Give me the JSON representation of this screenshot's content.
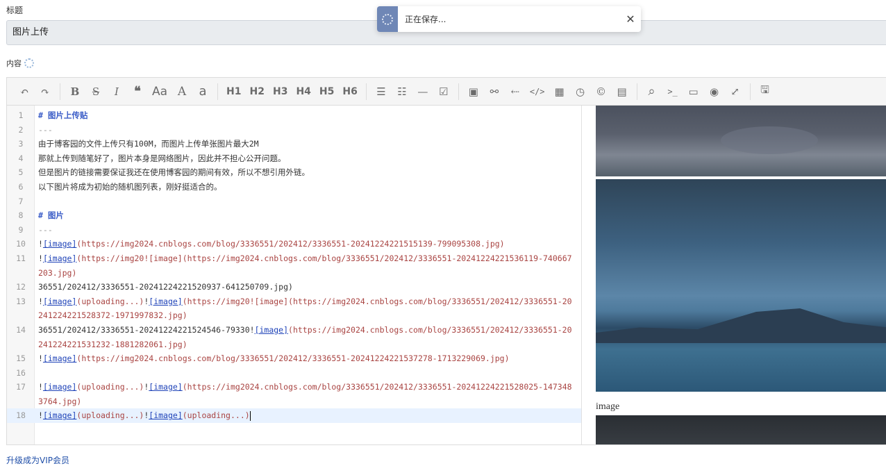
{
  "form": {
    "title_label": "标题",
    "title_value": "图片上传",
    "content_label": "内容"
  },
  "toast": {
    "message": "正在保存...",
    "close_glyph": "✕"
  },
  "toolbar": {
    "undo": "↶",
    "redo": "↷",
    "bold": "B",
    "strikethrough": "S",
    "italic": "I",
    "quote": "❝",
    "uppercase": "Aa",
    "capital": "A",
    "lowercase": "a",
    "h1": "H1",
    "h2": "H2",
    "h3": "H3",
    "h4": "H4",
    "h5": "H5",
    "h6": "H6",
    "ul": "☰",
    "ol": "☷",
    "hr": "—",
    "checkbox": "☑",
    "image": "▣",
    "link": "⚯",
    "anchor": "⇠",
    "code": "</>",
    "table": "▦",
    "datetime": "◷",
    "copyright": "©",
    "pagebreak": "▤",
    "search": "⌕",
    "terminal": ">_",
    "preview": "▭",
    "watch": "◉",
    "fullscreen": "⤢",
    "save": "🖫"
  },
  "lines": [
    {
      "n": "1",
      "segs": [
        {
          "t": "# 图片上传贴",
          "c": "hdr"
        }
      ]
    },
    {
      "n": "2",
      "segs": [
        {
          "t": "---",
          "c": "hr"
        }
      ]
    },
    {
      "n": "3",
      "segs": [
        {
          "t": "由于博客园的文件上传只有100M，而图片上传单张图片最大2M",
          "c": ""
        }
      ]
    },
    {
      "n": "4",
      "segs": [
        {
          "t": "那就上传到随笔好了，图片本身是网络图片，因此并不担心公开问题。",
          "c": ""
        }
      ]
    },
    {
      "n": "5",
      "segs": [
        {
          "t": "但是图片的链接需要保证我还在使用博客园的期间有效，所以不想引用外链。",
          "c": ""
        }
      ]
    },
    {
      "n": "6",
      "segs": [
        {
          "t": "以下图片将成为初始的随机图列表，刚好挺适合的。",
          "c": ""
        }
      ]
    },
    {
      "n": "7",
      "segs": []
    },
    {
      "n": "8",
      "segs": [
        {
          "t": "# 图片",
          "c": "hdr"
        }
      ]
    },
    {
      "n": "9",
      "segs": [
        {
          "t": "---",
          "c": "hr"
        }
      ]
    },
    {
      "n": "10",
      "segs": [
        {
          "t": "!",
          "c": "bang"
        },
        {
          "t": "[image]",
          "c": "ltext"
        },
        {
          "t": "(https://img2024.cnblogs.com/blog/3336551/202412/3336551-20241224221515139-799095308.jpg)",
          "c": "lurl"
        }
      ]
    },
    {
      "n": "11",
      "segs": [
        {
          "t": "!",
          "c": "bang"
        },
        {
          "t": "[image]",
          "c": "ltext"
        },
        {
          "t": "(https://img20![image](https://img2024.cnblogs.com/blog/3336551/202412/3336551-20241224221536119-740667203.jpg)",
          "c": "lurl"
        }
      ]
    },
    {
      "n": "12",
      "segs": [
        {
          "t": "36551/202412/3336551-20241224221520937-641250709.jpg)",
          "c": ""
        }
      ]
    },
    {
      "n": "13",
      "segs": [
        {
          "t": "!",
          "c": "bang"
        },
        {
          "t": "[image]",
          "c": "ltext"
        },
        {
          "t": "(uploading...)",
          "c": "lurl"
        },
        {
          "t": "!",
          "c": "bang"
        },
        {
          "t": "[image]",
          "c": "ltext"
        },
        {
          "t": "(https://img20![image](https://img2024.cnblogs.com/blog/3336551/202412/3336551-20241224221528372-1971997832.jpg)",
          "c": "lurl"
        }
      ]
    },
    {
      "n": "14",
      "segs": [
        {
          "t": "36551/202412/3336551-20241224221524546-79330!",
          "c": ""
        },
        {
          "t": "[image]",
          "c": "ltext"
        },
        {
          "t": "(https://img2024.cnblogs.com/blog/3336551/202412/3336551-20241224221531232-1881282061.jpg)",
          "c": "lurl"
        }
      ]
    },
    {
      "n": "15",
      "segs": [
        {
          "t": "!",
          "c": "bang"
        },
        {
          "t": "[image]",
          "c": "ltext"
        },
        {
          "t": "(https://img2024.cnblogs.com/blog/3336551/202412/3336551-20241224221537278-1713229069.jpg)",
          "c": "lurl"
        }
      ]
    },
    {
      "n": "16",
      "segs": []
    },
    {
      "n": "17",
      "segs": [
        {
          "t": "!",
          "c": "bang"
        },
        {
          "t": "[image]",
          "c": "ltext"
        },
        {
          "t": "(uploading...)",
          "c": "lurl"
        },
        {
          "t": "!",
          "c": "bang"
        },
        {
          "t": "[image]",
          "c": "ltext"
        },
        {
          "t": "(https://img2024.cnblogs.com/blog/3336551/202412/3336551-20241224221528025-1473483764.jpg)",
          "c": "lurl"
        }
      ]
    },
    {
      "n": "18",
      "segs": [
        {
          "t": "!",
          "c": "bang"
        },
        {
          "t": "[image]",
          "c": "ltext"
        },
        {
          "t": "(uploading...)",
          "c": "lurl"
        },
        {
          "t": "!",
          "c": "bang"
        },
        {
          "t": "[image]",
          "c": "ltext"
        },
        {
          "t": "(uploading...)",
          "c": "lurl"
        }
      ],
      "active": true
    }
  ],
  "preview": {
    "broken_alt": "image"
  },
  "footer": {
    "link": "升级成为VIP会员"
  }
}
